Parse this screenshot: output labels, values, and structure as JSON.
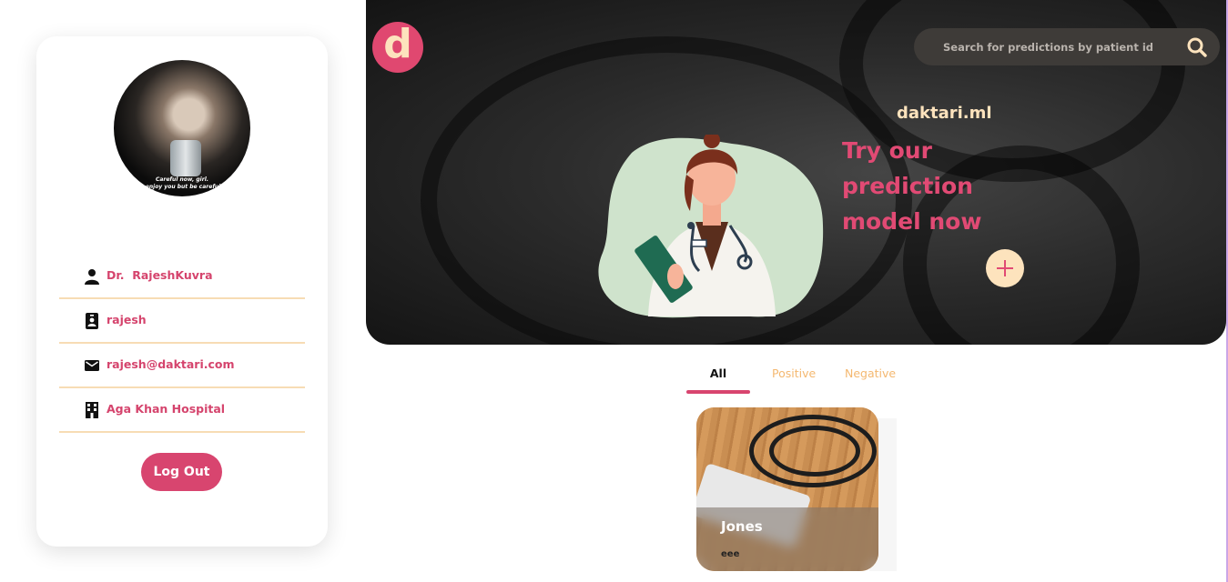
{
  "profile": {
    "name_prefix": "Dr.",
    "name": "RajeshKuvra",
    "username": "rajesh",
    "email": "rajesh@daktari.com",
    "hospital": "Aga Khan Hospital",
    "avatar_caption_1": "Careful now, girl.",
    "avatar_caption_2": "I enjoy you but be careful.",
    "logout_label": "Log Out"
  },
  "header": {
    "logo_letter": "d",
    "search_placeholder": "Search for predictions by patient id",
    "brand": "daktari.ml",
    "tagline": "Try our prediction model now",
    "plus_label": "+"
  },
  "tabs": [
    {
      "label": "All",
      "active": true
    },
    {
      "label": "Positive",
      "active": false
    },
    {
      "label": "Negative",
      "active": false
    }
  ],
  "predictions": [
    {
      "name": "Jones",
      "subtitle": "eee"
    }
  ],
  "colors": {
    "accent": "#d8456f",
    "cream": "#fde3bd",
    "tab_inactive": "#f4b870",
    "divider": "#f7dcb4"
  },
  "icons": {
    "name": "person-icon",
    "username": "id-badge-icon",
    "email": "mail-icon",
    "hospital": "building-icon",
    "search": "search-icon",
    "add": "plus-icon"
  }
}
